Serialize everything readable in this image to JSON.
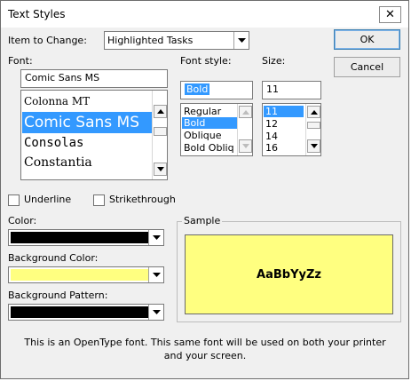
{
  "window": {
    "title": "Text Styles"
  },
  "item_to_change": {
    "label": "Item to Change:",
    "value": "Highlighted Tasks"
  },
  "buttons": {
    "ok": "OK",
    "cancel": "Cancel"
  },
  "font": {
    "label": "Font:",
    "value": "Comic Sans MS",
    "items": [
      "Colonna MT",
      "Comic Sans MS",
      "Consolas",
      "Constantia"
    ],
    "selected": "Comic Sans MS"
  },
  "font_style": {
    "label": "Font style:",
    "value": "Bold",
    "items": [
      "Regular",
      "Bold",
      "Oblique",
      "Bold Obliq"
    ],
    "selected": "Bold"
  },
  "size": {
    "label": "Size:",
    "value": "11",
    "items": [
      "11",
      "12",
      "14",
      "16"
    ],
    "selected": "11"
  },
  "effects": {
    "underline": "Underline",
    "strikethrough": "Strikethrough"
  },
  "color": {
    "label": "Color:",
    "swatch": "#000000"
  },
  "background_color": {
    "label": "Background Color:",
    "swatch": "#ffff80"
  },
  "background_pattern": {
    "label": "Background Pattern:",
    "swatch": "#000000"
  },
  "sample": {
    "label": "Sample",
    "text": "AaBbYyZz",
    "background": "#ffff80"
  },
  "info": "This is an OpenType font. This same font will be used on both your printer and your screen.",
  "colors": {
    "selection": "#3399ff",
    "dialog_bg": "#f0f0f0"
  }
}
